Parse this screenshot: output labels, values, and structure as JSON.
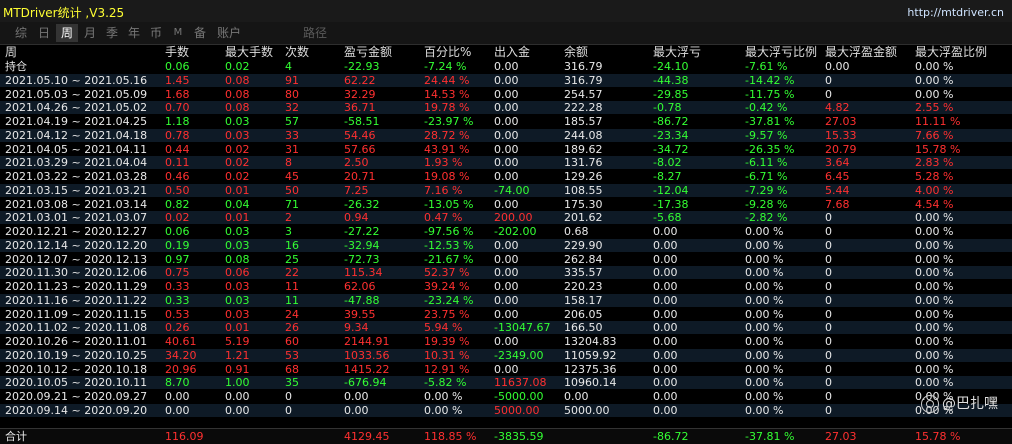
{
  "window": {
    "title": "MTDriver统计 ,V3.25",
    "link": "http://mtdriver.cn"
  },
  "toolbar": {
    "buttons": [
      "综",
      "日",
      "周",
      "月",
      "季",
      "年",
      "币",
      "M",
      "备",
      "账户",
      "路径"
    ],
    "active": "周"
  },
  "table": {
    "headers": [
      "周",
      "手数",
      "最大手数",
      "次数",
      "盈亏金额",
      "百分比%",
      "出入金",
      "余额",
      "最大浮亏",
      "最大浮亏比例",
      "最大浮盈金额",
      "最大浮盈比例"
    ],
    "rows": [
      {
        "c": [
          "持仓",
          "0.06",
          "0.02",
          "4",
          "-22.93",
          "-7.24 %",
          "0.00",
          "316.79",
          "-24.10",
          "-7.61 %",
          "0.00",
          "0.00 %"
        ],
        "k": [
          "w",
          "g",
          "g",
          "g",
          "g",
          "g",
          "w",
          "w",
          "g",
          "g",
          "w",
          "w"
        ]
      },
      {
        "c": [
          "2021.05.10 ~ 2021.05.16",
          "1.45",
          "0.08",
          "91",
          "62.22",
          "24.44 %",
          "0.00",
          "316.79",
          "-44.38",
          "-14.42 %",
          "0",
          "0.00 %"
        ],
        "k": [
          "w",
          "r",
          "r",
          "r",
          "r",
          "r",
          "w",
          "w",
          "g",
          "g",
          "w",
          "w"
        ]
      },
      {
        "c": [
          "2021.05.03 ~ 2021.05.09",
          "1.68",
          "0.08",
          "80",
          "32.29",
          "14.53 %",
          "0.00",
          "254.57",
          "-29.85",
          "-11.75 %",
          "0",
          "0.00 %"
        ],
        "k": [
          "w",
          "r",
          "r",
          "r",
          "r",
          "r",
          "w",
          "w",
          "g",
          "g",
          "w",
          "w"
        ]
      },
      {
        "c": [
          "2021.04.26 ~ 2021.05.02",
          "0.70",
          "0.08",
          "32",
          "36.71",
          "19.78 %",
          "0.00",
          "222.28",
          "-0.78",
          "-0.42 %",
          "4.82",
          "2.55 %"
        ],
        "k": [
          "w",
          "r",
          "r",
          "r",
          "r",
          "r",
          "w",
          "w",
          "g",
          "g",
          "r",
          "r"
        ]
      },
      {
        "c": [
          "2021.04.19 ~ 2021.04.25",
          "1.18",
          "0.03",
          "57",
          "-58.51",
          "-23.97 %",
          "0.00",
          "185.57",
          "-86.72",
          "-37.81 %",
          "27.03",
          "11.11 %"
        ],
        "k": [
          "w",
          "g",
          "g",
          "g",
          "g",
          "g",
          "w",
          "w",
          "g",
          "g",
          "r",
          "r"
        ]
      },
      {
        "c": [
          "2021.04.12 ~ 2021.04.18",
          "0.78",
          "0.03",
          "33",
          "54.46",
          "28.72 %",
          "0.00",
          "244.08",
          "-23.34",
          "-9.57 %",
          "15.33",
          "7.66 %"
        ],
        "k": [
          "w",
          "r",
          "r",
          "r",
          "r",
          "r",
          "w",
          "w",
          "g",
          "g",
          "r",
          "r"
        ]
      },
      {
        "c": [
          "2021.04.05 ~ 2021.04.11",
          "0.44",
          "0.02",
          "31",
          "57.66",
          "43.91 %",
          "0.00",
          "189.62",
          "-34.72",
          "-26.35 %",
          "20.79",
          "15.78 %"
        ],
        "k": [
          "w",
          "r",
          "r",
          "r",
          "r",
          "r",
          "w",
          "w",
          "g",
          "g",
          "r",
          "r"
        ]
      },
      {
        "c": [
          "2021.03.29 ~ 2021.04.04",
          "0.11",
          "0.02",
          "8",
          "2.50",
          "1.93 %",
          "0.00",
          "131.76",
          "-8.02",
          "-6.11 %",
          "3.64",
          "2.83 %"
        ],
        "k": [
          "w",
          "r",
          "r",
          "r",
          "r",
          "r",
          "w",
          "w",
          "g",
          "g",
          "r",
          "r"
        ]
      },
      {
        "c": [
          "2021.03.22 ~ 2021.03.28",
          "0.46",
          "0.02",
          "45",
          "20.71",
          "19.08 %",
          "0.00",
          "129.26",
          "-8.27",
          "-6.71 %",
          "6.45",
          "5.28 %"
        ],
        "k": [
          "w",
          "r",
          "r",
          "r",
          "r",
          "r",
          "w",
          "w",
          "g",
          "g",
          "r",
          "r"
        ]
      },
      {
        "c": [
          "2021.03.15 ~ 2021.03.21",
          "0.50",
          "0.01",
          "50",
          "7.25",
          "7.16 %",
          "-74.00",
          "108.55",
          "-12.04",
          "-7.29 %",
          "5.44",
          "4.00 %"
        ],
        "k": [
          "w",
          "r",
          "r",
          "r",
          "r",
          "r",
          "g",
          "w",
          "g",
          "g",
          "r",
          "r"
        ]
      },
      {
        "c": [
          "2021.03.08 ~ 2021.03.14",
          "0.82",
          "0.04",
          "71",
          "-26.32",
          "-13.05 %",
          "0.00",
          "175.30",
          "-17.38",
          "-9.28 %",
          "7.68",
          "4.54 %"
        ],
        "k": [
          "w",
          "g",
          "g",
          "g",
          "g",
          "g",
          "w",
          "w",
          "g",
          "g",
          "r",
          "r"
        ]
      },
      {
        "c": [
          "2021.03.01 ~ 2021.03.07",
          "0.02",
          "0.01",
          "2",
          "0.94",
          "0.47 %",
          "200.00",
          "201.62",
          "-5.68",
          "-2.82 %",
          "0",
          "0.00 %"
        ],
        "k": [
          "w",
          "r",
          "r",
          "r",
          "r",
          "r",
          "r",
          "w",
          "g",
          "g",
          "w",
          "w"
        ]
      },
      {
        "c": [
          "2020.12.21 ~ 2020.12.27",
          "0.06",
          "0.03",
          "3",
          "-27.22",
          "-97.56 %",
          "-202.00",
          "0.68",
          "0.00",
          "0.00 %",
          "0",
          "0.00 %"
        ],
        "k": [
          "w",
          "g",
          "g",
          "g",
          "g",
          "g",
          "g",
          "w",
          "w",
          "w",
          "w",
          "w"
        ]
      },
      {
        "c": [
          "2020.12.14 ~ 2020.12.20",
          "0.19",
          "0.03",
          "16",
          "-32.94",
          "-12.53 %",
          "0.00",
          "229.90",
          "0.00",
          "0.00 %",
          "0",
          "0.00 %"
        ],
        "k": [
          "w",
          "g",
          "g",
          "g",
          "g",
          "g",
          "w",
          "w",
          "w",
          "w",
          "w",
          "w"
        ]
      },
      {
        "c": [
          "2020.12.07 ~ 2020.12.13",
          "0.97",
          "0.08",
          "25",
          "-72.73",
          "-21.67 %",
          "0.00",
          "262.84",
          "0.00",
          "0.00 %",
          "0",
          "0.00 %"
        ],
        "k": [
          "w",
          "g",
          "g",
          "g",
          "g",
          "g",
          "w",
          "w",
          "w",
          "w",
          "w",
          "w"
        ]
      },
      {
        "c": [
          "2020.11.30 ~ 2020.12.06",
          "0.75",
          "0.06",
          "22",
          "115.34",
          "52.37 %",
          "0.00",
          "335.57",
          "0.00",
          "0.00 %",
          "0",
          "0.00 %"
        ],
        "k": [
          "w",
          "r",
          "r",
          "r",
          "r",
          "r",
          "w",
          "w",
          "w",
          "w",
          "w",
          "w"
        ]
      },
      {
        "c": [
          "2020.11.23 ~ 2020.11.29",
          "0.33",
          "0.03",
          "11",
          "62.06",
          "39.24 %",
          "0.00",
          "220.23",
          "0.00",
          "0.00 %",
          "0",
          "0.00 %"
        ],
        "k": [
          "w",
          "r",
          "r",
          "r",
          "r",
          "r",
          "w",
          "w",
          "w",
          "w",
          "w",
          "w"
        ]
      },
      {
        "c": [
          "2020.11.16 ~ 2020.11.22",
          "0.33",
          "0.03",
          "11",
          "-47.88",
          "-23.24 %",
          "0.00",
          "158.17",
          "0.00",
          "0.00 %",
          "0",
          "0.00 %"
        ],
        "k": [
          "w",
          "g",
          "g",
          "g",
          "g",
          "g",
          "w",
          "w",
          "w",
          "w",
          "w",
          "w"
        ]
      },
      {
        "c": [
          "2020.11.09 ~ 2020.11.15",
          "0.53",
          "0.03",
          "24",
          "39.55",
          "23.75 %",
          "0.00",
          "206.05",
          "0.00",
          "0.00 %",
          "0",
          "0.00 %"
        ],
        "k": [
          "w",
          "r",
          "r",
          "r",
          "r",
          "r",
          "w",
          "w",
          "w",
          "w",
          "w",
          "w"
        ]
      },
      {
        "c": [
          "2020.11.02 ~ 2020.11.08",
          "0.26",
          "0.01",
          "26",
          "9.34",
          "5.94 %",
          "-13047.67",
          "166.50",
          "0.00",
          "0.00 %",
          "0",
          "0.00 %"
        ],
        "k": [
          "w",
          "r",
          "r",
          "r",
          "r",
          "r",
          "g",
          "w",
          "w",
          "w",
          "w",
          "w"
        ]
      },
      {
        "c": [
          "2020.10.26 ~ 2020.11.01",
          "40.61",
          "5.19",
          "60",
          "2144.91",
          "19.39 %",
          "0.00",
          "13204.83",
          "0.00",
          "0.00 %",
          "0",
          "0.00 %"
        ],
        "k": [
          "w",
          "r",
          "r",
          "r",
          "r",
          "r",
          "w",
          "w",
          "w",
          "w",
          "w",
          "w"
        ]
      },
      {
        "c": [
          "2020.10.19 ~ 2020.10.25",
          "34.20",
          "1.21",
          "53",
          "1033.56",
          "10.31 %",
          "-2349.00",
          "11059.92",
          "0.00",
          "0.00 %",
          "0",
          "0.00 %"
        ],
        "k": [
          "w",
          "r",
          "r",
          "r",
          "r",
          "r",
          "g",
          "w",
          "w",
          "w",
          "w",
          "w"
        ]
      },
      {
        "c": [
          "2020.10.12 ~ 2020.10.18",
          "20.96",
          "0.91",
          "68",
          "1415.22",
          "12.91 %",
          "0.00",
          "12375.36",
          "0.00",
          "0.00 %",
          "0",
          "0.00 %"
        ],
        "k": [
          "w",
          "r",
          "r",
          "r",
          "r",
          "r",
          "w",
          "w",
          "w",
          "w",
          "w",
          "w"
        ]
      },
      {
        "c": [
          "2020.10.05 ~ 2020.10.11",
          "8.70",
          "1.00",
          "35",
          "-676.94",
          "-5.82 %",
          "11637.08",
          "10960.14",
          "0.00",
          "0.00 %",
          "0",
          "0.00 %"
        ],
        "k": [
          "w",
          "g",
          "g",
          "g",
          "g",
          "g",
          "r",
          "w",
          "w",
          "w",
          "w",
          "w"
        ]
      },
      {
        "c": [
          "2020.09.21 ~ 2020.09.27",
          "0.00",
          "0.00",
          "0",
          "0.00",
          "0.00 %",
          "-5000.00",
          "0.00",
          "0.00",
          "0.00 %",
          "0",
          "0.00 %"
        ],
        "k": [
          "w",
          "w",
          "w",
          "w",
          "w",
          "w",
          "g",
          "w",
          "w",
          "w",
          "w",
          "w"
        ]
      },
      {
        "c": [
          "2020.09.14 ~ 2020.09.20",
          "0.00",
          "0.00",
          "0",
          "0.00",
          "0.00 %",
          "5000.00",
          "5000.00",
          "0.00",
          "0.00 %",
          "0",
          "0.00 %"
        ],
        "k": [
          "w",
          "w",
          "w",
          "w",
          "w",
          "w",
          "r",
          "w",
          "w",
          "w",
          "w",
          "w"
        ]
      }
    ],
    "total": {
      "c": [
        "合计",
        "116.09",
        "",
        "",
        "4129.45",
        "118.85 %",
        "-3835.59",
        "",
        "-86.72",
        "-37.81 %",
        "27.03",
        "15.78 %"
      ],
      "k": [
        "w",
        "r",
        "w",
        "w",
        "r",
        "r",
        "g",
        "w",
        "g",
        "g",
        "r",
        "r"
      ]
    }
  },
  "watermark": "@巴扎嘿",
  "colors": {
    "red": "#ff3030",
    "green": "#33ff33",
    "title": "#ffff33",
    "background": "#000000"
  }
}
